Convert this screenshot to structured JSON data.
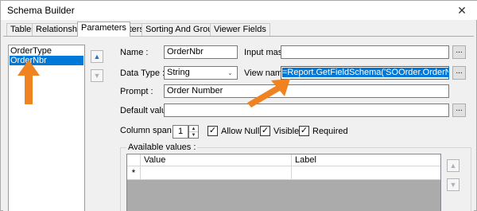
{
  "window": {
    "title": "Schema Builder",
    "close_label": "✕"
  },
  "tabs": [
    {
      "label": "Tables",
      "active": false
    },
    {
      "label": "Relationships",
      "active": false
    },
    {
      "label": "Parameters",
      "active": true
    },
    {
      "label": "Filters",
      "active": false
    },
    {
      "label": "Sorting And Grouping",
      "active": false
    },
    {
      "label": "Viewer Fields",
      "active": false
    }
  ],
  "parameters_list": {
    "items": [
      {
        "label": "OrderType",
        "selected": false
      },
      {
        "label": "OrderNbr",
        "selected": true
      }
    ]
  },
  "move_buttons": {
    "up_icon": "arrow-up-icon",
    "down_icon": "arrow-down-icon",
    "up_glyph": "▲",
    "down_glyph": "▼"
  },
  "form": {
    "name_label": "Name :",
    "name_value": "OrderNbr",
    "input_mask_label": "Input mask :",
    "input_mask_value": "",
    "data_type_label": "Data Type :",
    "data_type_value": "String",
    "view_name_label": "View name :",
    "view_name_value": "=Report.GetFieldSchema('SOOrder.OrderNbr,OrderType')",
    "prompt_label": "Prompt :",
    "prompt_value": "Order Number",
    "default_value_label": "Default value :",
    "default_value_value": "",
    "column_span_label": "Column span :",
    "column_span_value": "1",
    "ellipsis_label": "...",
    "allow_null_label": "Allow Null",
    "allow_null_checked": true,
    "visible_label": "Visible",
    "visible_checked": true,
    "required_label": "Required",
    "required_checked": true,
    "check_glyph": "✓",
    "combo_glyph": "⌄"
  },
  "available_values": {
    "legend": "Available values :",
    "columns": [
      "Value",
      "Label"
    ],
    "new_row_marker": "*"
  },
  "colors": {
    "accent": "#0078d7",
    "annotation_arrow": "#f08321"
  }
}
